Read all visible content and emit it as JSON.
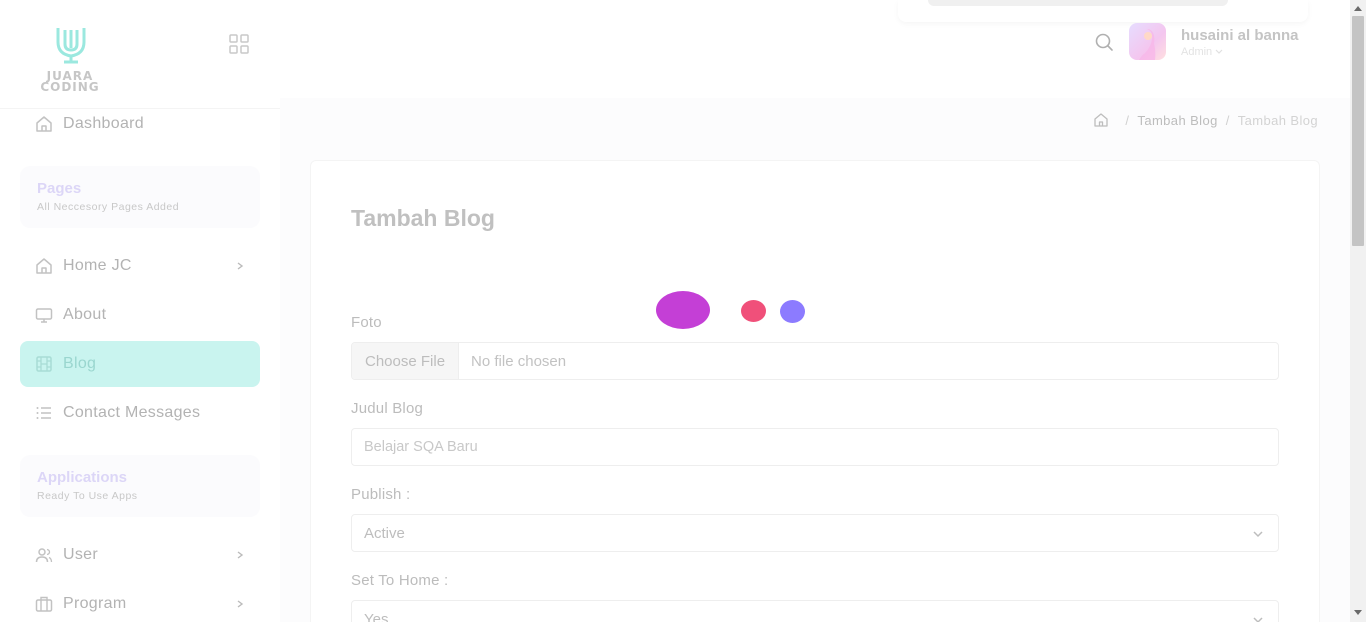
{
  "brand": {
    "logo_text_line1": "JUARA",
    "logo_text_line2": "CODING",
    "accent": "#c9f4ef",
    "logo_color": "#9be8df"
  },
  "sidebar": {
    "dashboard": "Dashboard",
    "pages_section": {
      "title": "Pages",
      "subtitle": "All Neccesory Pages Added"
    },
    "items": [
      {
        "label": "Home JC",
        "icon": "home-icon",
        "has_children": true
      },
      {
        "label": "About",
        "icon": "monitor-icon",
        "has_children": false
      },
      {
        "label": "Blog",
        "icon": "film-icon",
        "has_children": false,
        "active": true
      },
      {
        "label": "Contact Messages",
        "icon": "list-icon",
        "has_children": false
      }
    ],
    "apps_section": {
      "title": "Applications",
      "subtitle": "Ready To Use Apps"
    },
    "app_items": [
      {
        "label": "User",
        "icon": "users-icon",
        "has_children": true
      },
      {
        "label": "Program",
        "icon": "briefcase-icon",
        "has_children": true
      }
    ]
  },
  "header": {
    "user_name": "husaini al banna",
    "user_role": "Admin"
  },
  "breadcrumb": {
    "items": [
      "Tambah Blog",
      "Tambah Blog"
    ]
  },
  "form": {
    "title": "Tambah Blog",
    "foto_label": "Foto",
    "file_button": "Choose File",
    "file_status": "No file chosen",
    "judul_label": "Judul Blog",
    "judul_value": "Belajar SQA Baru",
    "publish_label": "Publish :",
    "publish_value": "Active",
    "home_label": "Set To Home :",
    "home_value": "Yes"
  },
  "loader_colors": [
    "#c43fd6",
    "#f0507a",
    "#8c7bff"
  ]
}
